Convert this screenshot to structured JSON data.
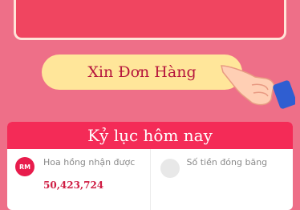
{
  "order_button": {
    "label": "Xin Đơn Hàng"
  },
  "record_card": {
    "title": "Kỷ lục hôm nay",
    "commission": {
      "icon_text": "RM",
      "label": "Hoa hồng nhận được",
      "value": "50,423,724"
    },
    "frozen": {
      "label": "Số tiền đóng băng"
    }
  },
  "colors": {
    "background": "#ee6f88",
    "accent": "#f42b57",
    "button": "#ffe69a",
    "button_text": "#b6163d"
  }
}
